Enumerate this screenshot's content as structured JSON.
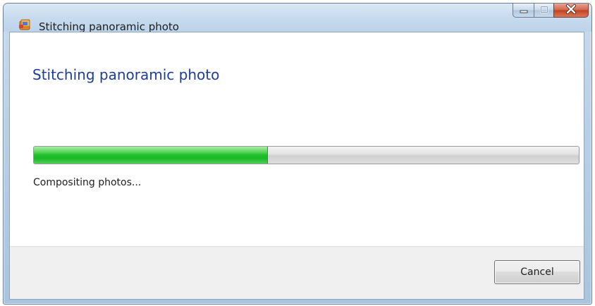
{
  "window": {
    "title": "Stitching panoramic photo"
  },
  "dialog": {
    "heading": "Stitching panoramic photo",
    "status": "Compositing photos...",
    "progress_fraction": 0.43
  },
  "footer": {
    "cancel_label": "Cancel"
  },
  "icons": {
    "app": "photo-gallery-icon",
    "minimize": "minimize-icon",
    "maximize": "maximize-icon",
    "close": "close-icon"
  },
  "colors": {
    "heading": "#1e3e9a",
    "progress_fill": "#1fbf2c",
    "close_button": "#c2401f"
  }
}
